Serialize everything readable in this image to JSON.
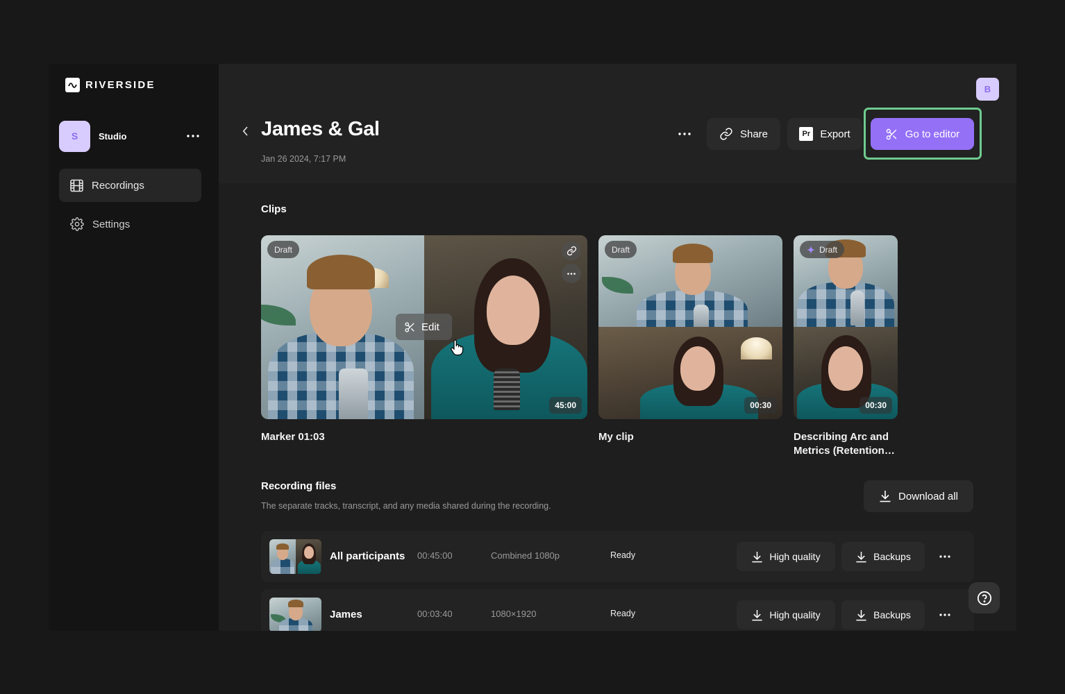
{
  "app": {
    "brand": "RIVERSIDE",
    "accent_color": "#9470f7",
    "highlight_color": "#6fcc8f"
  },
  "sidebar": {
    "workspace": {
      "initial": "S",
      "name": "Studio"
    },
    "items": [
      {
        "label": "Recordings",
        "icon": "film-icon",
        "active": true
      },
      {
        "label": "Settings",
        "icon": "gear-icon",
        "active": false
      }
    ]
  },
  "header": {
    "user_initial": "B",
    "title": "James & Gal",
    "date": "Jan 26 2024, 7:17 PM",
    "buttons": {
      "share": "Share",
      "export": "Export",
      "export_badge": "Pr",
      "editor": "Go to editor"
    }
  },
  "clips": {
    "title": "Clips",
    "items": [
      {
        "name": "Marker 01:03",
        "badge": "Draft",
        "duration": "45:00",
        "hover_action": "Edit"
      },
      {
        "name": "My clip",
        "badge": "Draft",
        "duration": "00:30"
      },
      {
        "name": "Describing Arc and Metrics (Retention…",
        "badge": "Draft",
        "duration": "00:30",
        "ai_generated": true
      }
    ]
  },
  "recording_files": {
    "title": "Recording files",
    "description": "The separate tracks, transcript, and any media shared during the recording.",
    "download_all": "Download all",
    "rows": [
      {
        "name": "All participants",
        "duration": "00:45:00",
        "resolution": "Combined 1080p",
        "status": "Ready",
        "hq_label": "High quality",
        "backup_label": "Backups"
      },
      {
        "name": "James",
        "duration": "00:03:40",
        "resolution": "1080×1920",
        "status": "Ready",
        "hq_label": "High quality",
        "backup_label": "Backups"
      }
    ]
  }
}
